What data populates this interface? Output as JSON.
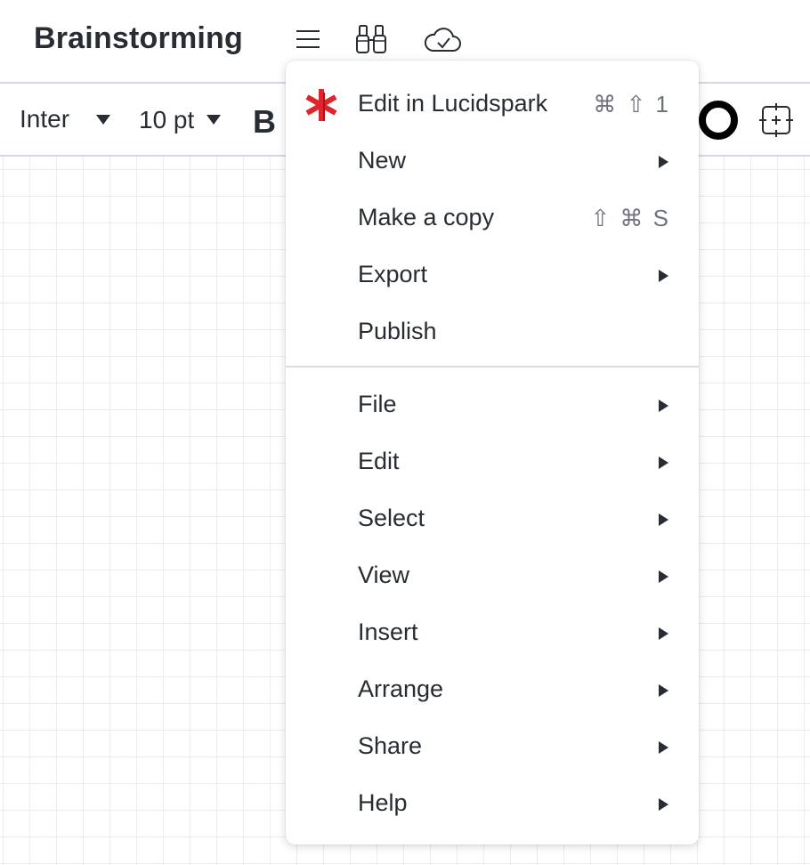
{
  "header": {
    "title": "Brainstorming",
    "icons": [
      "hamburger-menu-icon",
      "binoculars-icon",
      "cloud-check-icon"
    ]
  },
  "toolbar": {
    "font": "Inter",
    "font_size": "10 pt",
    "bold_label": "B"
  },
  "menu": {
    "items": [
      {
        "label": "Edit in Lucidspark",
        "shortcut": "⌘ ⇧ 1",
        "icon": "lucidspark-asterisk-icon"
      },
      {
        "label": "New",
        "submenu": true
      },
      {
        "label": "Make a copy",
        "shortcut": "⇧ ⌘ S"
      },
      {
        "label": "Export",
        "submenu": true
      },
      {
        "label": "Publish"
      },
      {
        "label": "File",
        "submenu": true
      },
      {
        "label": "Edit",
        "submenu": true
      },
      {
        "label": "Select",
        "submenu": true
      },
      {
        "label": "View",
        "submenu": true
      },
      {
        "label": "Insert",
        "submenu": true
      },
      {
        "label": "Arrange",
        "submenu": true
      },
      {
        "label": "Share",
        "submenu": true
      },
      {
        "label": "Help",
        "submenu": true
      }
    ]
  },
  "colors": {
    "text": "#282c33",
    "shortcut": "#6f7380",
    "divider": "#dcdce4",
    "spark_red": "#e0242c"
  }
}
